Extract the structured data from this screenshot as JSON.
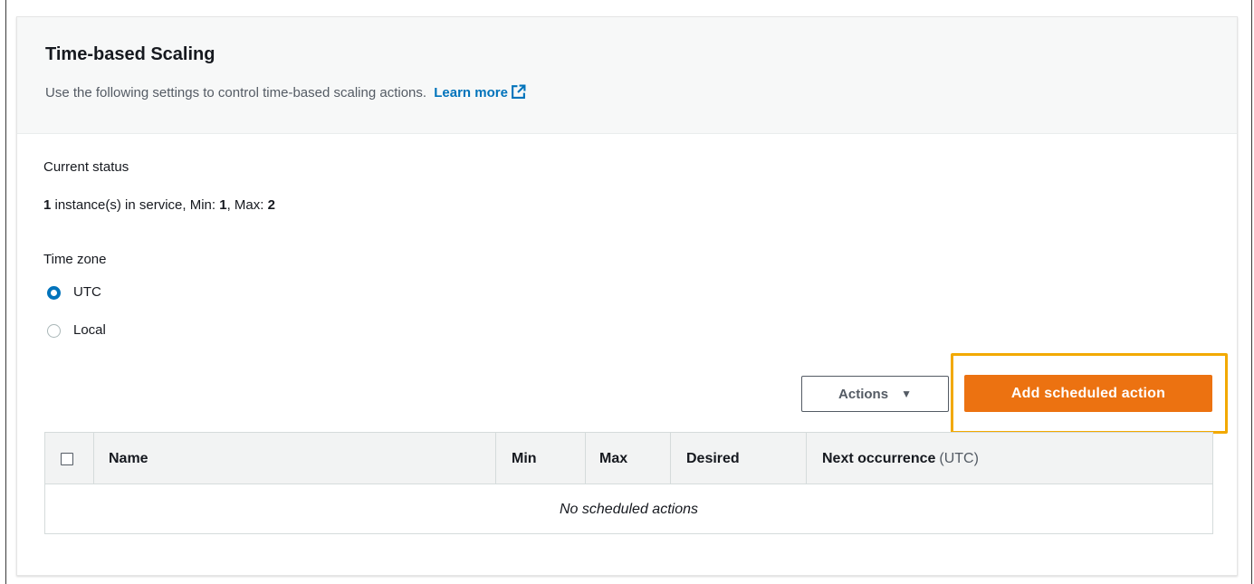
{
  "panel": {
    "title": "Time-based Scaling",
    "description": "Use the following settings to control time-based scaling actions.",
    "learn_more": "Learn more"
  },
  "status": {
    "label": "Current status",
    "instances": "1",
    "instances_text": " instance(s) in service, Min: ",
    "min": "1",
    "max_text": ", Max: ",
    "max": "2"
  },
  "timezone": {
    "label": "Time zone",
    "options": [
      {
        "label": "UTC",
        "selected": true
      },
      {
        "label": "Local",
        "selected": false
      }
    ]
  },
  "buttons": {
    "actions": "Actions",
    "add": "Add scheduled action"
  },
  "table": {
    "columns": [
      "Name",
      "Min",
      "Max",
      "Desired",
      "Next occurrence"
    ],
    "next_suffix": "(UTC)",
    "empty_message": "No scheduled actions"
  },
  "icons": {
    "external_link": "external-link-icon",
    "caret": "caret-down-icon"
  },
  "colors": {
    "accent": "#0073bb",
    "primary_button": "#ec7211",
    "highlight": "#f2a900"
  }
}
